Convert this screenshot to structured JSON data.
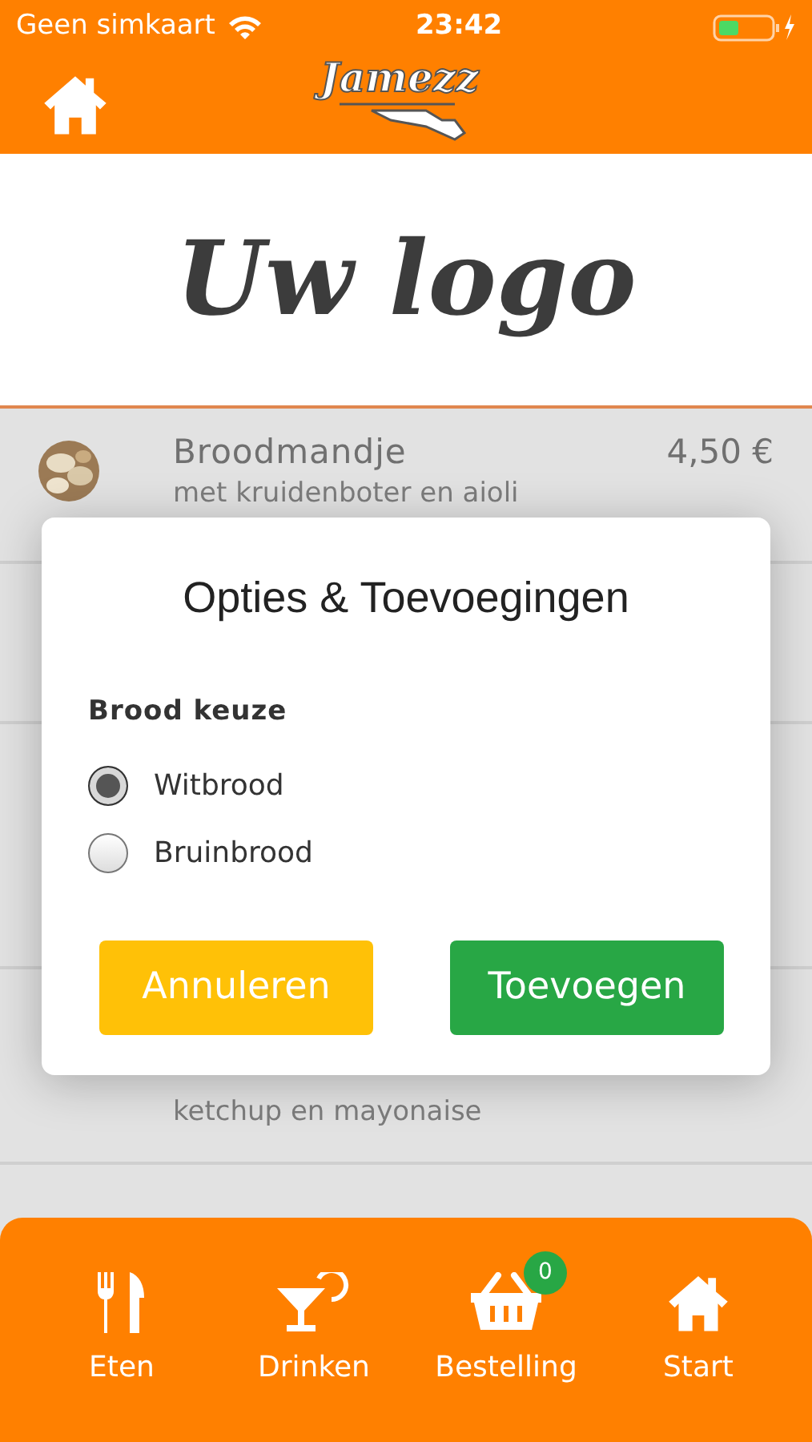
{
  "status_bar": {
    "carrier": "Geen simkaart",
    "time": "23:42"
  },
  "header": {
    "brand": "Jamezz"
  },
  "logo_banner": {
    "text": "Uw logo"
  },
  "menu_items": [
    {
      "name": "Broodmandje",
      "price": "4,50 €",
      "description": "met kruidenboter en aioli"
    },
    {
      "description": "ketchup en mayonaise"
    }
  ],
  "dialog": {
    "title": "Opties & Toevoegingen",
    "group_label": "Brood keuze",
    "options": [
      {
        "label": "Witbrood",
        "selected": true
      },
      {
        "label": "Bruinbrood",
        "selected": false
      }
    ],
    "buttons": [
      {
        "label": "Annuleren",
        "kind": "cancel"
      },
      {
        "label": "Toevoegen",
        "kind": "confirm"
      }
    ]
  },
  "bottom_nav": [
    {
      "label": "Eten",
      "kind": "food"
    },
    {
      "label": "Drinken",
      "kind": "drinks"
    },
    {
      "label": "Bestelling",
      "kind": "basket",
      "badge": "0"
    },
    {
      "label": "Start",
      "kind": "home"
    }
  ]
}
